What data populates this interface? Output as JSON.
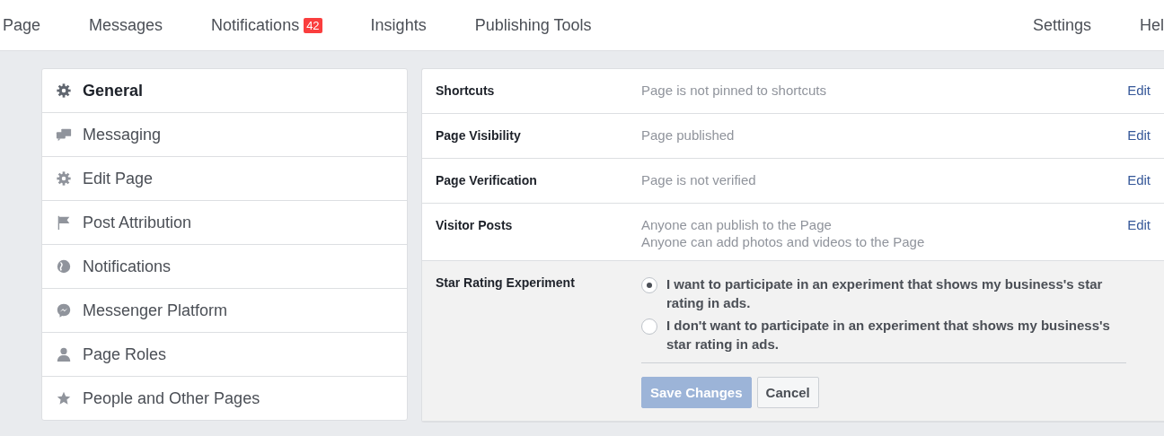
{
  "nav": {
    "items": [
      {
        "label": "Page"
      },
      {
        "label": "Messages"
      },
      {
        "label": "Notifications",
        "badge": "42"
      },
      {
        "label": "Insights"
      },
      {
        "label": "Publishing Tools"
      }
    ],
    "right_items": [
      {
        "label": "Settings"
      },
      {
        "label": "Hel"
      }
    ]
  },
  "sidebar": {
    "items": [
      {
        "label": "General",
        "selected": true
      },
      {
        "label": "Messaging",
        "selected": false
      },
      {
        "label": "Edit Page",
        "selected": false
      },
      {
        "label": "Post Attribution",
        "selected": false
      },
      {
        "label": "Notifications",
        "selected": false
      },
      {
        "label": "Messenger Platform",
        "selected": false
      },
      {
        "label": "Page Roles",
        "selected": false
      },
      {
        "label": "People and Other Pages",
        "selected": false
      }
    ]
  },
  "settings": {
    "rows": [
      {
        "label": "Shortcuts",
        "values": [
          "Page is not pinned to shortcuts"
        ],
        "action": "Edit"
      },
      {
        "label": "Page Visibility",
        "values": [
          "Page published"
        ],
        "action": "Edit"
      },
      {
        "label": "Page Verification",
        "values": [
          "Page is not verified"
        ],
        "action": "Edit"
      },
      {
        "label": "Visitor Posts",
        "values": [
          "Anyone can publish to the Page",
          "Anyone can add photos and videos to the Page"
        ],
        "action": "Edit"
      }
    ],
    "expanded": {
      "label": "Star Rating Experiment",
      "options": [
        {
          "label": "I want to participate in an experiment that shows my business's star rating in ads.",
          "selected": true
        },
        {
          "label": "I don't want to participate in an experiment that shows my business's star rating in ads.",
          "selected": false
        }
      ],
      "save": {
        "label": "Save Changes",
        "disabled": true
      },
      "cancel": {
        "label": "Cancel"
      }
    }
  }
}
